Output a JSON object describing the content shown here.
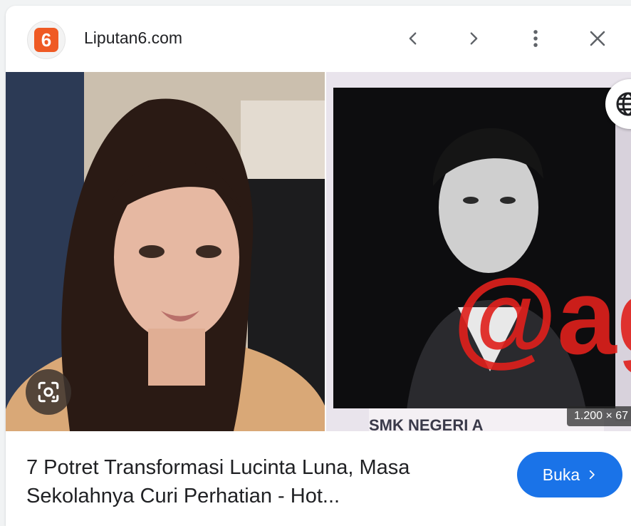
{
  "header": {
    "site_logo_text": "6",
    "site_name": "Liputan6.com",
    "icons": [
      "chevron-left-icon",
      "chevron-right-icon",
      "more-vert-icon",
      "close-icon"
    ]
  },
  "preview": {
    "dimensions": "1.200 × 67",
    "watermark_text": "@ag",
    "badge_text": "SMK NEGERI A"
  },
  "result": {
    "title_line1": "7 Potret Transformasi Lucinta Luna, Masa",
    "title_line2": "Sekolahnya Curi Perhatian - Hot...",
    "open_label": "Buka"
  },
  "colors": {
    "accent": "#1a73e8",
    "logo": "#ef5a24",
    "watermark": "#e0201c"
  }
}
